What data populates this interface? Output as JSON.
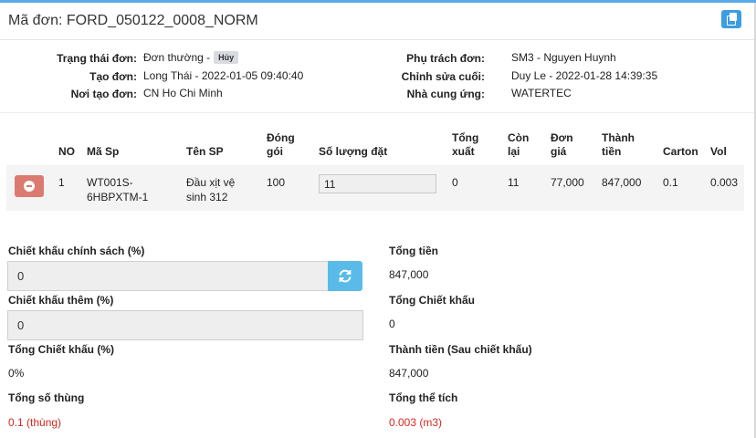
{
  "header": {
    "title": "Mã đơn: FORD_050122_0008_NORM"
  },
  "info": {
    "status_label": "Trạng thái đơn:",
    "status_value": "Đơn thường -",
    "cancel_badge": "Hủy",
    "created_label": "Tạo đơn:",
    "created_value": "Long Thái - 2022-01-05 09:40:40",
    "place_label": "Nơi tạo đơn:",
    "place_value": "CN Ho Chi Minh",
    "owner_label": "Phụ trách đơn:",
    "owner_value": "SM3 - Nguyen Huynh",
    "edited_label": "Chỉnh sửa cuối:",
    "edited_value": "Duy Le - 2022-01-28 14:39:35",
    "supplier_label": "Nhà cung ứng:",
    "supplier_value": "WATERTEC"
  },
  "table": {
    "headers": {
      "no": "NO",
      "sku": "Mã Sp",
      "name": "Tên SP",
      "pack_1": "Đóng",
      "pack_2": "gói",
      "qty": "Số lượng đặt",
      "exported_1": "Tổng",
      "exported_2": "xuất",
      "remaining_1": "Còn",
      "remaining_2": "lại",
      "price_1": "Đơn",
      "price_2": "giá",
      "amount_1": "Thành",
      "amount_2": "tiền",
      "carton": "Carton",
      "vol": "Vol"
    },
    "rows": [
      {
        "no": "1",
        "sku_1": "WT001S-",
        "sku_2": "6HBPXTM-1",
        "name_1": "Đầu xịt vệ",
        "name_2": "sinh 312",
        "pack": "100",
        "qty": "11",
        "exported": "0",
        "remaining": "11",
        "price": "77,000",
        "amount": "847,000",
        "carton": "0.1",
        "vol": "0.003"
      }
    ]
  },
  "summary": {
    "policy_discount_label": "Chiết khấu chính sách (%)",
    "policy_discount_value": "0",
    "extra_discount_label": "Chiết khấu thêm (%)",
    "extra_discount_value": "0",
    "total_discount_pct_label": "Tổng Chiết khấu (%)",
    "total_discount_pct_value": "0%",
    "total_boxes_label": "Tổng số thùng",
    "total_boxes_value": "0.1 (thùng)",
    "total_label": "Tổng tiền",
    "total_value": "847,000",
    "total_discount_label": "Tổng Chiết khấu",
    "total_discount_value": "0",
    "net_label": "Thành tiền (Sau chiết khấu)",
    "net_value": "847,000",
    "total_volume_label": "Tổng thể tích",
    "total_volume_value": "0.003 (m3)"
  },
  "colors": {
    "accent": "#5aa9e6",
    "copy_button": "#3c9de0",
    "remove_button": "#db7a70",
    "refresh_button": "#5bbbe8",
    "red_text": "#d9261c"
  },
  "icons": {
    "copy": "copy-icon",
    "remove": "minus-circle-icon",
    "refresh": "refresh-icon"
  }
}
